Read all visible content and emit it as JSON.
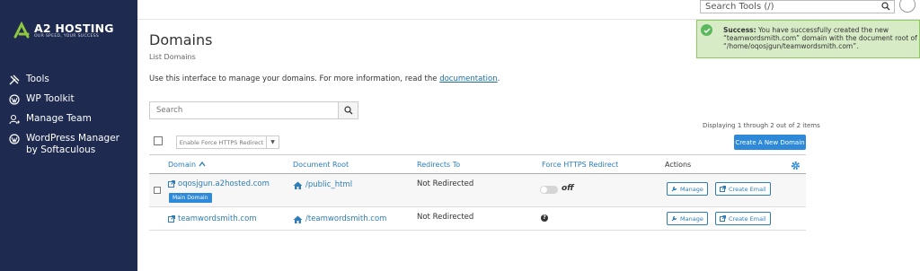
{
  "brand": {
    "name": "A2 HOSTING",
    "tagline": "OUR SPEED, YOUR SUCCESS",
    "accent_color": "#8dc63f",
    "sidebar_bg": "#1e2a4f"
  },
  "sidebar": {
    "items": [
      {
        "label": "Tools",
        "icon": "tools-icon"
      },
      {
        "label": "WP Toolkit",
        "icon": "wordpress-icon"
      },
      {
        "label": "Manage Team",
        "icon": "team-icon"
      },
      {
        "label": "WordPress Manager by Softaculous",
        "icon": "wordpress-icon"
      }
    ]
  },
  "header": {
    "search_placeholder": "Search Tools (/)"
  },
  "notice": {
    "title": "Success:",
    "message": " You have successfully created the new “teamwordsmith.com” domain with the document root of “/home/oqosjgun/teamwordsmith.com”."
  },
  "page": {
    "title": "Domains",
    "breadcrumb": "List Domains",
    "intro": "Use this interface to manage your domains. For more information, read the ",
    "intro_link": "documentation",
    "intro_end": "."
  },
  "toolbar": {
    "search_placeholder": "Search",
    "displaying": "Displaying 1 through 2 out of 2 items",
    "create_label": "Create A New Domain",
    "force_https_label": "Enable Force HTTPS Redirect"
  },
  "table": {
    "headers": {
      "domain": "Domain",
      "docroot": "Document Root",
      "redirects": "Redirects To",
      "https": "Force HTTPS Redirect",
      "actions": "Actions"
    },
    "rows": [
      {
        "domain": "oqosjgun.a2hosted.com",
        "badge": "Main Domain",
        "docroot": "/public_html",
        "redirects": "Not Redirected",
        "https": "off",
        "manage": "Manage",
        "create_email": "Create Email"
      },
      {
        "domain": "teamwordsmith.com",
        "docroot": "/teamwordsmith.com",
        "redirects": "Not Redirected",
        "https": "?",
        "manage": "Manage",
        "create_email": "Create Email"
      }
    ]
  }
}
